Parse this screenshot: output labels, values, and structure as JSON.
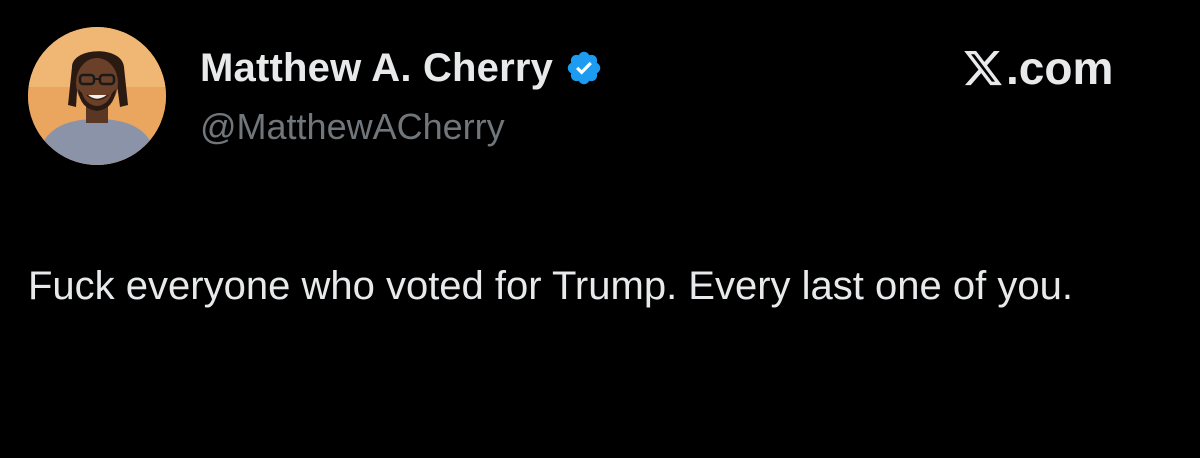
{
  "author": {
    "display_name": "Matthew A. Cherry",
    "handle": "@MatthewACherry",
    "verified": true,
    "avatar_icon": "avatar-photo"
  },
  "brand": {
    "logo_icon": "x-logo-icon",
    "label": ".com"
  },
  "tweet": {
    "text": "Fuck everyone who voted for Trump. Every last one of you."
  },
  "colors": {
    "background": "#000000",
    "text_primary": "#e7e9ea",
    "text_secondary": "#71767b",
    "verified_badge": "#1d9bf0"
  }
}
